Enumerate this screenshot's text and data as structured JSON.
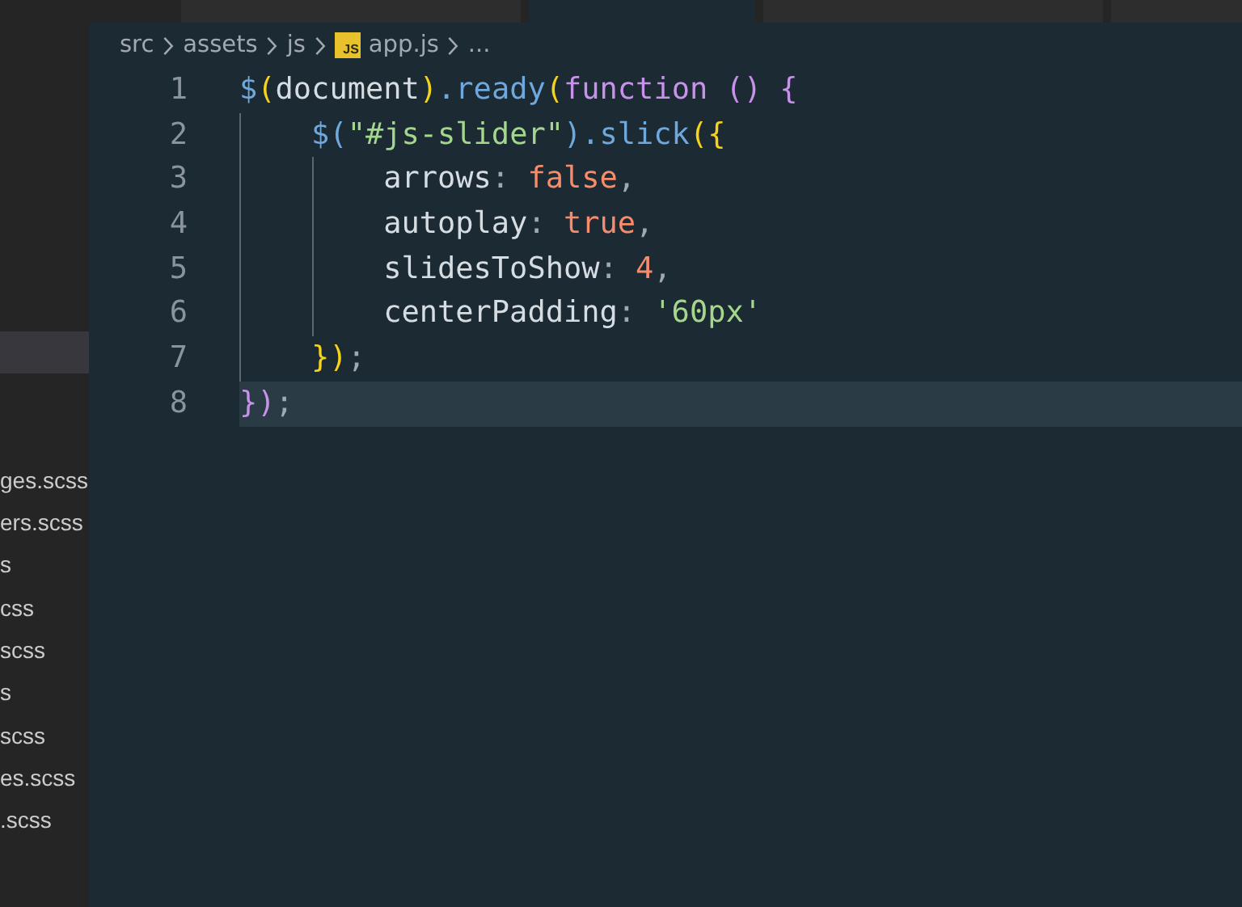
{
  "tabs": [
    {
      "selected": false
    },
    {
      "selected": true
    },
    {
      "selected": false
    },
    {
      "selected": false
    }
  ],
  "breadcrumb": [
    "src",
    "assets",
    "js",
    "app.js",
    "..."
  ],
  "file_badge": "JS",
  "sidebar": {
    "items": [
      {
        "selected": true
      },
      {
        "label": "ges.scss",
        "selected": false
      },
      {
        "label": "ers.scss",
        "selected": false
      },
      {
        "label": "s",
        "selected": false
      },
      {
        "label": "css",
        "selected": false
      },
      {
        "label": "scss",
        "selected": false
      },
      {
        "label": "s",
        "selected": false
      },
      {
        "label": "scss",
        "selected": false
      },
      {
        "label": "es.scss",
        "selected": false
      },
      {
        "label": ".scss",
        "selected": false
      }
    ]
  },
  "editor": {
    "lines": [
      {
        "number": "1",
        "current": false,
        "tokens": [
          {
            "kind": "fn",
            "text": "$"
          },
          {
            "kind": "paren1",
            "text": "("
          },
          {
            "kind": "plain",
            "text": "document"
          },
          {
            "kind": "paren1",
            "text": ")"
          },
          {
            "kind": "fn",
            "text": ".ready"
          },
          {
            "kind": "paren1",
            "text": "("
          },
          {
            "kind": "keyword",
            "text": "function"
          },
          {
            "kind": "paren2",
            "text": " () {"
          }
        ]
      },
      {
        "number": "2",
        "current": false,
        "tokens": [
          {
            "kind": "indent"
          },
          {
            "kind": "fn",
            "text": "$("
          },
          {
            "kind": "string",
            "text": "\"#js-slider\""
          },
          {
            "kind": "fn",
            "text": ").slick"
          },
          {
            "kind": "paren1",
            "text": "({"
          }
        ]
      },
      {
        "number": "3",
        "current": false,
        "tokens": [
          {
            "kind": "indent"
          },
          {
            "kind": "indent"
          },
          {
            "kind": "plain",
            "text": "arrows"
          },
          {
            "kind": "punct",
            "text": ": "
          },
          {
            "kind": "literal",
            "text": "false"
          },
          {
            "kind": "punct",
            "text": ","
          }
        ]
      },
      {
        "number": "4",
        "current": false,
        "tokens": [
          {
            "kind": "indent"
          },
          {
            "kind": "indent"
          },
          {
            "kind": "plain",
            "text": "autoplay"
          },
          {
            "kind": "punct",
            "text": ": "
          },
          {
            "kind": "literal",
            "text": "true"
          },
          {
            "kind": "punct",
            "text": ","
          }
        ]
      },
      {
        "number": "5",
        "current": false,
        "tokens": [
          {
            "kind": "indent"
          },
          {
            "kind": "indent"
          },
          {
            "kind": "plain",
            "text": "slidesToShow"
          },
          {
            "kind": "punct",
            "text": ": "
          },
          {
            "kind": "literal",
            "text": "4"
          },
          {
            "kind": "punct",
            "text": ","
          }
        ]
      },
      {
        "number": "6",
        "current": false,
        "tokens": [
          {
            "kind": "indent"
          },
          {
            "kind": "indent"
          },
          {
            "kind": "plain",
            "text": "centerPadding"
          },
          {
            "kind": "punct",
            "text": ": "
          },
          {
            "kind": "string",
            "text": "'60px'"
          }
        ]
      },
      {
        "number": "7",
        "current": false,
        "tokens": [
          {
            "kind": "indent"
          },
          {
            "kind": "paren1",
            "text": "})"
          },
          {
            "kind": "punct",
            "text": ";"
          }
        ]
      },
      {
        "number": "8",
        "current": true,
        "tokens": [
          {
            "kind": "paren2",
            "text": "})"
          },
          {
            "kind": "punct",
            "text": ";"
          }
        ]
      }
    ]
  }
}
